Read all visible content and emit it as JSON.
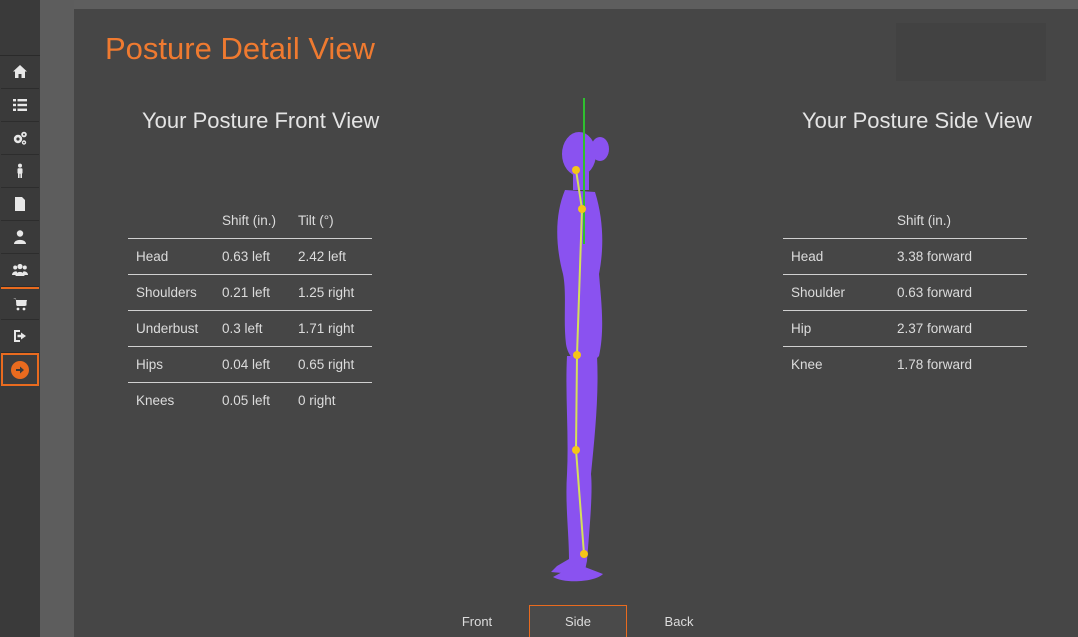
{
  "sidebar": {
    "items": [
      {
        "icon": "home-icon"
      },
      {
        "icon": "list-icon"
      },
      {
        "icon": "gears-icon"
      },
      {
        "icon": "person-icon"
      },
      {
        "icon": "document-icon"
      },
      {
        "icon": "user-icon"
      },
      {
        "icon": "users-icon"
      },
      {
        "icon": "cart-icon"
      },
      {
        "icon": "sign-out-icon"
      },
      {
        "icon": "arrow-right-circle-icon"
      }
    ]
  },
  "page": {
    "title": "Posture Detail View"
  },
  "front_view": {
    "title": "Your Posture Front View",
    "columns": [
      "",
      "Shift (in.)",
      "Tilt (°)"
    ],
    "rows": [
      {
        "label": "Head",
        "shift": "0.63 left",
        "tilt": "2.42 left"
      },
      {
        "label": "Shoulders",
        "shift": "0.21 left",
        "tilt": "1.25 right"
      },
      {
        "label": "Underbust",
        "shift": "0.3 left",
        "tilt": "1.71 right"
      },
      {
        "label": "Hips",
        "shift": "0.04 left",
        "tilt": "0.65 right"
      },
      {
        "label": "Knees",
        "shift": "0.05 left",
        "tilt": "0 right"
      }
    ]
  },
  "side_view": {
    "title": "Your Posture Side View",
    "columns": [
      "",
      "Shift (in.)"
    ],
    "rows": [
      {
        "label": "Head",
        "shift": "3.38 forward"
      },
      {
        "label": "Shoulder",
        "shift": "0.63 forward"
      },
      {
        "label": "Hip",
        "shift": "2.37 forward"
      },
      {
        "label": "Knee",
        "shift": "1.78 forward"
      }
    ]
  },
  "view_tabs": {
    "front": "Front",
    "side": "Side",
    "back": "Back",
    "selected": "Side"
  },
  "colors": {
    "accent": "#e96b1f",
    "title": "#ef7a30",
    "body_model": "#8a52f0",
    "plumb_line": "#2fbf2f",
    "posture_line": "#d4e05a",
    "joint_marker": "#f5c518"
  }
}
